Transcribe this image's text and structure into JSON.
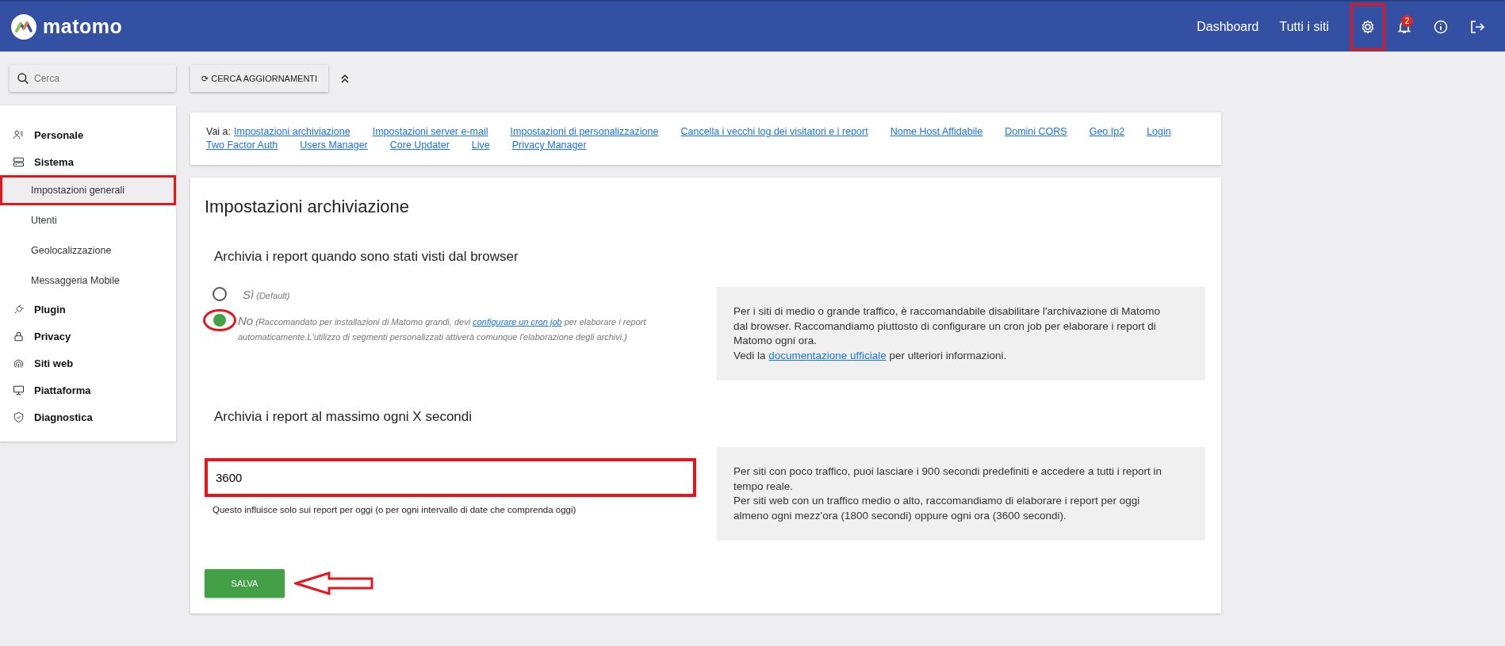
{
  "header": {
    "logo": "matomo",
    "nav": [
      "Dashboard",
      "Tutti i siti"
    ],
    "icons": [
      {
        "kind": "settings",
        "annotated": true
      },
      {
        "kind": "notifications",
        "badge": "2",
        "annotated": false
      },
      {
        "kind": "info",
        "annotated": false
      },
      {
        "kind": "logout",
        "annotated": false
      }
    ]
  },
  "search": {
    "placeholder": "Cerca"
  },
  "update_button": {
    "icon": "⟳",
    "label": "CERCA AGGIORNAMENTI"
  },
  "sidebar": {
    "sections": [
      {
        "label": "Personale"
      },
      {
        "label": "Sistema",
        "children": [
          {
            "label": "Impostazioni generali",
            "selected": true,
            "annotated": true
          },
          {
            "label": "Utenti",
            "selected": false,
            "annotated": false
          },
          {
            "label": "Geolocalizzazione",
            "selected": false,
            "annotated": false
          },
          {
            "label": "Messaggeria Mobile",
            "selected": false,
            "annotated": false
          }
        ]
      },
      {
        "label": "Plugin"
      },
      {
        "label": "Privacy"
      },
      {
        "label": "Siti web"
      },
      {
        "label": "Piattaforma"
      },
      {
        "label": "Diagnostica"
      }
    ]
  },
  "jump_links": {
    "label": "Vai a:",
    "links": [
      "Impostazioni archiviazione",
      "Impostazioni server e-mail",
      "Impostazioni di personalizzazione",
      "Cancella i vecchi log dei visitatori e i report",
      "Nome Host Affidabile",
      "Domini CORS",
      "Geo Ip2",
      "Login",
      "Two Factor Auth",
      "Users Manager",
      "Core Updater",
      "Live",
      "Privacy Manager"
    ]
  },
  "settings": {
    "title": "Impostazioni archiviazione",
    "fields": [
      {
        "kind": "radio",
        "heading": "Archivia i report quando sono stati visti dal browser",
        "options": [
          {
            "label": "Sì",
            "note": "(Default)",
            "selected": false,
            "annotated": false
          },
          {
            "label": "No",
            "note": "(Raccomandato per installazioni di Matomo grandi, devi ",
            "note_link": "configurare un cron job",
            "note_after": " per elaborare i report automaticamente.L'utilizzo di segmenti personalizzati attiverà comunque l'elaborazione degli archivi.)",
            "selected": true,
            "annotated": true
          }
        ],
        "help": [
          {
            "text": "Per i siti di medio o grande traffico, è raccomandabile disabilitare l'archivazione di Matomo dal browser. Raccomandiamo piuttosto di configurare un cron job per elaborare i report di Matomo ogni ora."
          },
          {
            "text": "Vedi la ",
            "link": "documentazione ufficiale",
            "after": " per ulteriori informazioni."
          }
        ]
      },
      {
        "kind": "text",
        "heading": "Archivia i report al massimo ogni X secondi",
        "value": "3600",
        "annotated": true,
        "hint": "Questo influisce solo sui report per oggi (o per ogni intervallo di date che comprenda oggi)",
        "help": [
          {
            "text": "Per siti con poco traffico, puoi lasciare i 900 secondi predefiniti e accedere a tutti i report in tempo reale."
          },
          {
            "text": "Per siti web con un traffico medio o alto, raccomandiamo di elaborare i report per oggi almeno ogni mezz'ora (1800 secondi) oppure ogni ora (3600 secondi)."
          }
        ]
      }
    ],
    "save": {
      "label": "SALVA",
      "arrow": true
    }
  }
}
